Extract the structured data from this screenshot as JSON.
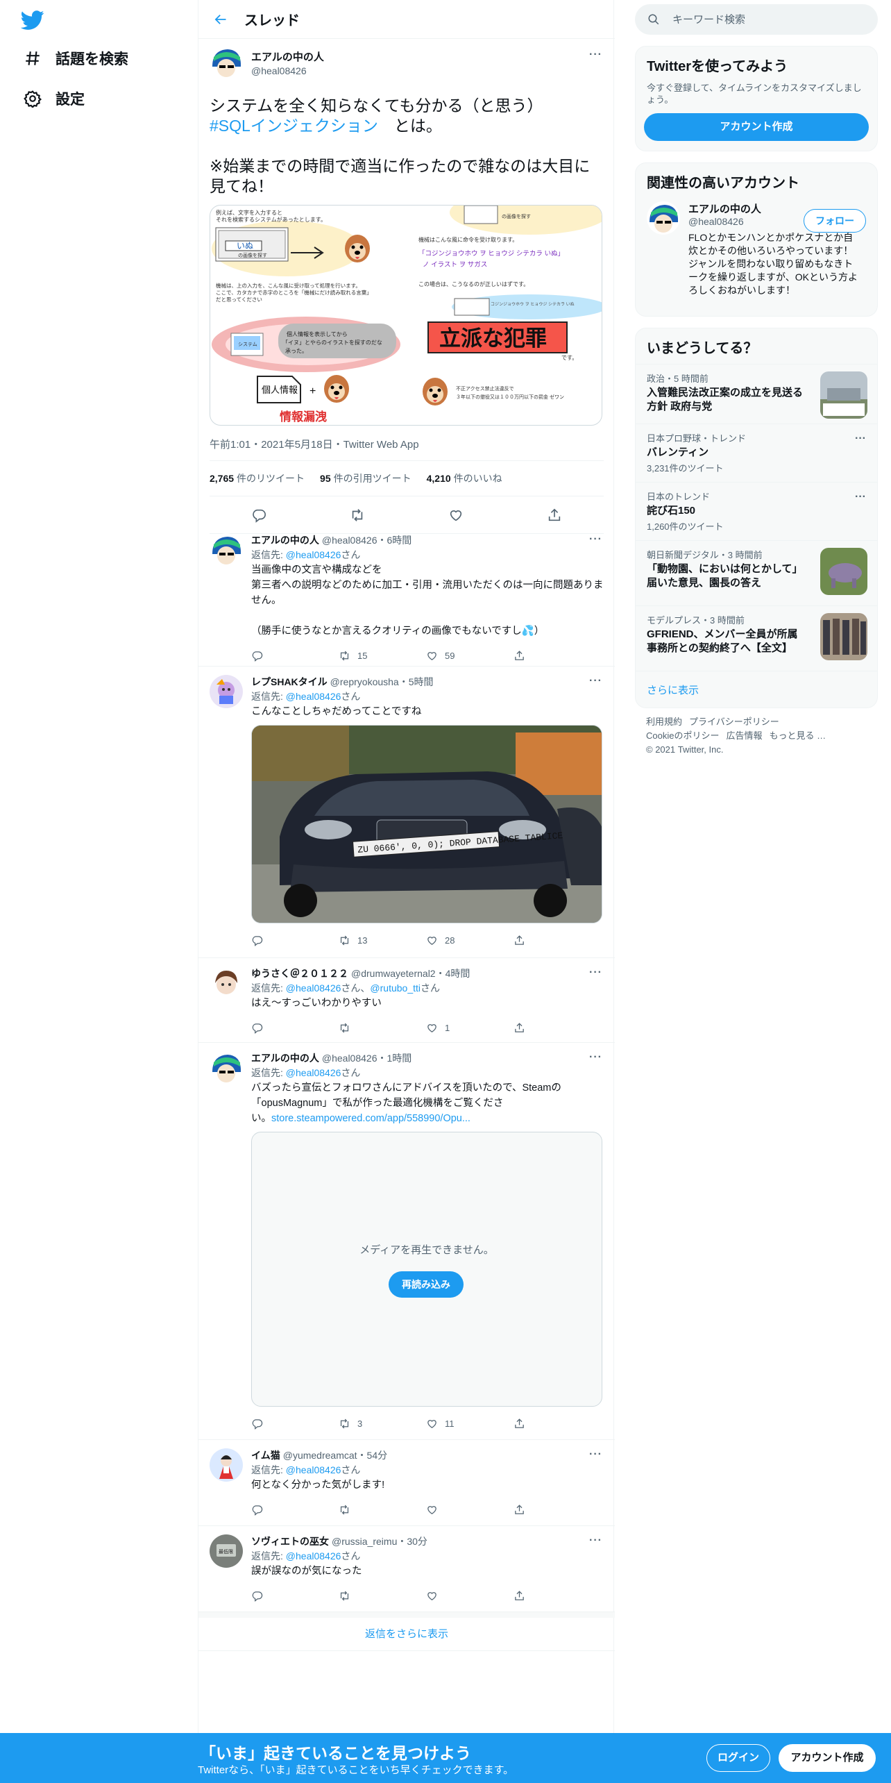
{
  "nav": {
    "items": [
      {
        "label": "話題を検索",
        "icon": "hashtag-icon"
      },
      {
        "label": "設定",
        "icon": "gear-icon"
      }
    ]
  },
  "header": {
    "title": "スレッド"
  },
  "main_tweet": {
    "name": "エアルの中の人",
    "handle": "@heal08426",
    "text_line1": "システムを全く知らなくても分かる（と思う）",
    "hashtag": "#SQLインジェクション",
    "text_line2_suffix": "　とは。",
    "text_line3": "※始業までの時間で適当に作ったので雑なのは大目に見てね！",
    "image": {
      "text_a": "例えば、文字を入力すると",
      "text_b": "それを検索するシステムがあったとします。",
      "input_word": "いぬ",
      "input_caption": "の画像を探す",
      "top_right_caption": "の画像を探す",
      "explain1": "機械は、上の入力を、こんな風に受け取って処理を行います。",
      "explain2": "ここで、カタカナで赤字のところを「機械にだけ読み取れる言葉」",
      "explain3": "だと思ってください",
      "mid_right1": "機械はこんな風に命令を受け取ります。",
      "mid_right2": "「コジンジョウホウ ヲ ヒョウジ シテカラ いぬ」",
      "mid_right3": "ノ イラスト ヲ サガス",
      "mid_right4": "この場合は、こうなるのが正しいはずです。",
      "pill_small": "コジンジョウホウ ヲ ヒョウジ シテカラ いぬ",
      "pill_label": "システム",
      "pill_text1": "個人情報を表示してから",
      "pill_text2": "「イヌ」とやらのイラストを探すのだな",
      "pill_text3": "承った。",
      "crime": "立派な犯罪",
      "desu": "です。",
      "doc_label": "個人情報",
      "plus": "+",
      "leak": "情報漏洩",
      "law1": "不正アクセス禁止法違反で",
      "law2": "３年以下の懲役又は１００万円以下の罰金 ゼワン"
    },
    "meta": "午前1:01・2021年5月18日・Twitter Web App",
    "retweets": "2,765",
    "retweets_label": "件のリツイート",
    "quotes": "95",
    "quotes_label": "件の引用ツイート",
    "likes": "4,210",
    "likes_label": "件のいいね"
  },
  "replies": [
    {
      "name": "エアルの中の人",
      "handle": "@heal08426",
      "time": "・6時間",
      "reply_to_prefix": "返信先: ",
      "reply_to": "@heal08426",
      "reply_to_suffix": "さん",
      "text": "当画像中の文言や構成などを\n第三者への説明などのために加工・引用・流用いただくのは一向に問題ありません。\n\n（勝手に使うなとか言えるクオリティの画像でもないですし💦）",
      "retweets": "15",
      "likes": "59"
    },
    {
      "name": "レプSHAKタイル",
      "handle": "@repryokousha",
      "time": "・5時間",
      "reply_to_prefix": "返信先: ",
      "reply_to": "@heal08426",
      "reply_to_suffix": "さん",
      "text": "こんなことしちゃだめってことですね",
      "plate_text": "ZU 0666', 0, 0); DROP DATABASE TABLICE",
      "retweets": "13",
      "likes": "28"
    },
    {
      "name": "ゆうさく＠２０１２２",
      "handle": "@drumwayeternal2",
      "time": "・4時間",
      "reply_to_prefix": "返信先: ",
      "reply_to": "@heal08426",
      "reply_to_mid": "さん、",
      "reply_to2": "@rutubo_tti",
      "reply_to_suffix": "さん",
      "text": "はえ～すっごいわかりやすい",
      "retweets": "",
      "likes": "1"
    },
    {
      "name": "エアルの中の人",
      "handle": "@heal08426",
      "time": "・1時間",
      "reply_to_prefix": "返信先: ",
      "reply_to": "@heal08426",
      "reply_to_suffix": "さん",
      "text": "バズったら宣伝とフォロワさんにアドバイスを頂いたので、Steamの「opusMagnum」で私が作った最適化機構をご覧くださ",
      "text_tail": "い。",
      "link": "store.steampowered.com/app/558990/Opu...",
      "media_error": "メディアを再生できません。",
      "reload": "再読み込み",
      "retweets": "3",
      "likes": "11"
    },
    {
      "name": "イム猫",
      "handle": "@yumedreamcat",
      "time": "・54分",
      "reply_to_prefix": "返信先: ",
      "reply_to": "@heal08426",
      "reply_to_suffix": "さん",
      "text": "何となく分かった気がします!",
      "retweets": "",
      "likes": ""
    },
    {
      "name": "ソヴィエトの巫女",
      "handle": "@russia_reimu",
      "time": "・30分",
      "reply_to_prefix": "返信先: ",
      "reply_to": "@heal08426",
      "reply_to_suffix": "さん",
      "text": "誤が誤なのが気になった",
      "avatar_text": "最低限",
      "retweets": "",
      "likes": ""
    }
  ],
  "show_more_replies": "返信をさらに表示",
  "search": {
    "placeholder": "キーワード検索"
  },
  "signup_card": {
    "title": "Twitterを使ってみよう",
    "desc": "今すぐ登録して、タイムラインをカスタマイズしましょう。",
    "button": "アカウント作成"
  },
  "relevant": {
    "title": "関連性の高いアカウント",
    "name": "エアルの中の人",
    "handle": "@heal08426",
    "follow": "フォロー",
    "bio": "FLOとかモンハンとかポケスナとか自炊とかその他いろいろやっています！ジャンルを問わない取り留めもなきトークを繰り返しますが、OKという方よろしくおねがいします！"
  },
  "trends": {
    "title": "いまどうしてる？",
    "items": [
      {
        "context": "政治・5 時間前",
        "title": "入管難民法改正案の成立を見送る方針 政府与党",
        "count": "",
        "thumb": "photo"
      },
      {
        "context": "日本プロ野球・トレンド",
        "title": "バレンティン",
        "count": "3,231件のツイート",
        "thumb": ""
      },
      {
        "context": "日本のトレンド",
        "title": "詫び石150",
        "count": "1,260件のツイート",
        "thumb": ""
      },
      {
        "context": "朝日新聞デジタル・3 時間前",
        "title": "「動物園、においは何とかして」届いた意見、園長の答え",
        "count": "",
        "thumb": "rhino"
      },
      {
        "context": "モデルプレス・3 時間前",
        "title": "GFRIEND、メンバー全員が所属事務所との契約終了へ【全文】",
        "count": "",
        "thumb": "group"
      }
    ],
    "show_more": "さらに表示"
  },
  "footer": {
    "links": [
      "利用規約",
      "プライバシーポリシー",
      "Cookieのポリシー",
      "広告情報",
      "もっと見る …"
    ],
    "copyright": "© 2021 Twitter, Inc."
  },
  "bottom_bar": {
    "title": "「いま」起きていることを見つけよう",
    "subtitle": "Twitterなら、「いま」起きていることをいち早くチェックできます。",
    "login": "ログイン",
    "signup": "アカウント作成"
  },
  "colors": {
    "accent": "#1d9bf0",
    "text": "#0f1419",
    "muted": "#536471",
    "crime_bg": "#f5554a"
  }
}
